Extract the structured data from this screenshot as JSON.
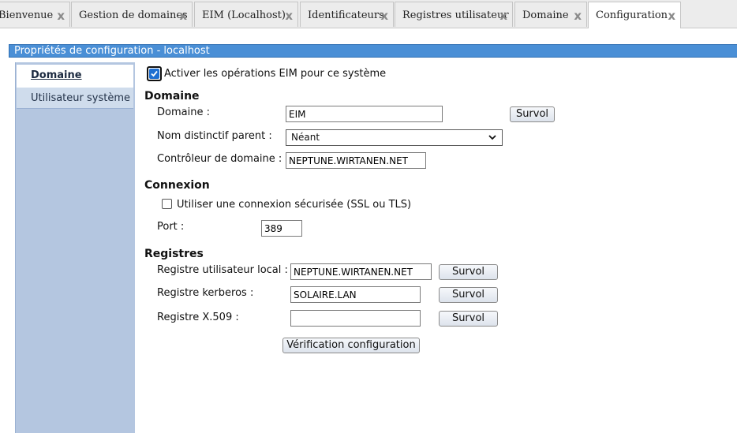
{
  "tabs": [
    {
      "label": "Bienvenue",
      "active": false
    },
    {
      "label": "Gestion de domaines",
      "active": false
    },
    {
      "label": "EIM (Localhost)",
      "active": false
    },
    {
      "label": "Identificateurs",
      "active": false
    },
    {
      "label": "Registres utilisateur",
      "active": false
    },
    {
      "label": "Domaine",
      "active": false
    },
    {
      "label": "Configuration",
      "active": true
    }
  ],
  "tab_close_glyph": "x",
  "panel": {
    "title": "Propriétés de configuration - localhost"
  },
  "sidebar": {
    "items": [
      {
        "label": "Domaine",
        "selected": true
      },
      {
        "label": "Utilisateur système",
        "selected": false
      }
    ]
  },
  "enable_eim": {
    "label": "Activer les opérations EIM pour ce système",
    "checked": true
  },
  "domain_section": {
    "title": "Domaine",
    "domain_label": "Domaine :",
    "domain_value": "EIM",
    "browse_label": "Survol",
    "parent_dn_label": "Nom distinctif parent :",
    "parent_dn_value": "Néant",
    "controller_label": "Contrôleur de domaine :",
    "controller_value": "NEPTUNE.WIRTANEN.NET"
  },
  "connection_section": {
    "title": "Connexion",
    "ssl_label": "Utiliser une connexion sécurisée (SSL ou TLS)",
    "ssl_checked": false,
    "port_label": "Port :",
    "port_value": "389"
  },
  "registries_section": {
    "title": "Registres",
    "local_label": "Registre utilisateur local :",
    "local_value": "NEPTUNE.WIRTANEN.NET",
    "kerberos_label": "Registre kerberos :",
    "kerberos_value": "SOLAIRE.LAN",
    "x509_label": "Registre X.509 :",
    "x509_value": "",
    "browse_label": "Survol"
  },
  "verify_button": "Vérification configuration",
  "colors": {
    "header": "#4a8fd6",
    "sidebar": "#b4c6e0",
    "checkbox": "#1f6fd1"
  },
  "icons": {
    "close": "close-icon",
    "dropdown": "chevron-down-icon",
    "check": "checkmark-icon"
  }
}
